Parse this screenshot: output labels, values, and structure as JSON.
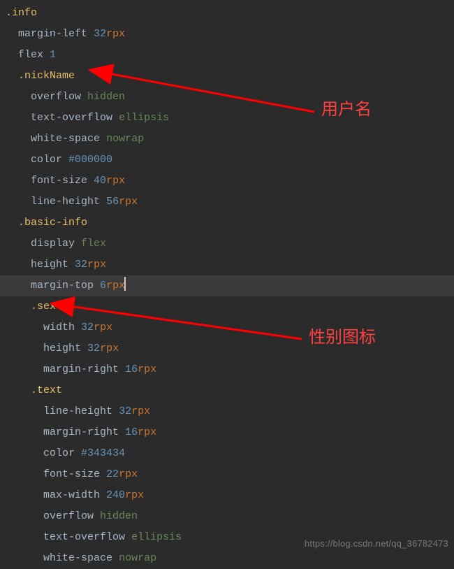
{
  "annotations": {
    "a1": "用户名",
    "a2": "性别图标"
  },
  "watermark": "https://blog.csdn.net/qq_36782473",
  "code": {
    "l0": {
      "sel": ".info"
    },
    "l1": {
      "prop": "margin-left",
      "num": "32",
      "unit": "rpx"
    },
    "l2": {
      "prop": "flex",
      "num": "1"
    },
    "l3": {
      "sel": ".nickName"
    },
    "l4": {
      "prop": "overflow",
      "kw": "hidden"
    },
    "l5": {
      "prop": "text-overflow",
      "kw": "ellipsis"
    },
    "l6": {
      "prop": "white-space",
      "kw": "nowrap"
    },
    "l7": {
      "prop": "color",
      "hex": "#000000"
    },
    "l8": {
      "prop": "font-size",
      "num": "40",
      "unit": "rpx"
    },
    "l9": {
      "prop": "line-height",
      "num": "56",
      "unit": "rpx"
    },
    "l10": {
      "sel": ".basic-info"
    },
    "l11": {
      "prop": "display",
      "kw": "flex"
    },
    "l12": {
      "prop": "height",
      "num": "32",
      "unit": "rpx"
    },
    "l13": {
      "prop": "margin-top",
      "num": "6",
      "unit": "rpx"
    },
    "l14": {
      "sel": ".sex"
    },
    "l15": {
      "prop": "width",
      "num": "32",
      "unit": "rpx"
    },
    "l16": {
      "prop": "height",
      "num": "32",
      "unit": "rpx"
    },
    "l17": {
      "prop": "margin-right",
      "num": "16",
      "unit": "rpx"
    },
    "l18": {
      "sel": ".text"
    },
    "l19": {
      "prop": "line-height",
      "num": "32",
      "unit": "rpx"
    },
    "l20": {
      "prop": "margin-right",
      "num": "16",
      "unit": "rpx"
    },
    "l21": {
      "prop": "color",
      "hex": "#343434"
    },
    "l22": {
      "prop": "font-size",
      "num": "22",
      "unit": "rpx"
    },
    "l23": {
      "prop": "max-width",
      "num": "240",
      "unit": "rpx"
    },
    "l24": {
      "prop": "overflow",
      "kw": "hidden"
    },
    "l25": {
      "prop": "text-overflow",
      "kw": "ellipsis"
    },
    "l26": {
      "prop": "white-space",
      "kw": "nowrap"
    }
  }
}
